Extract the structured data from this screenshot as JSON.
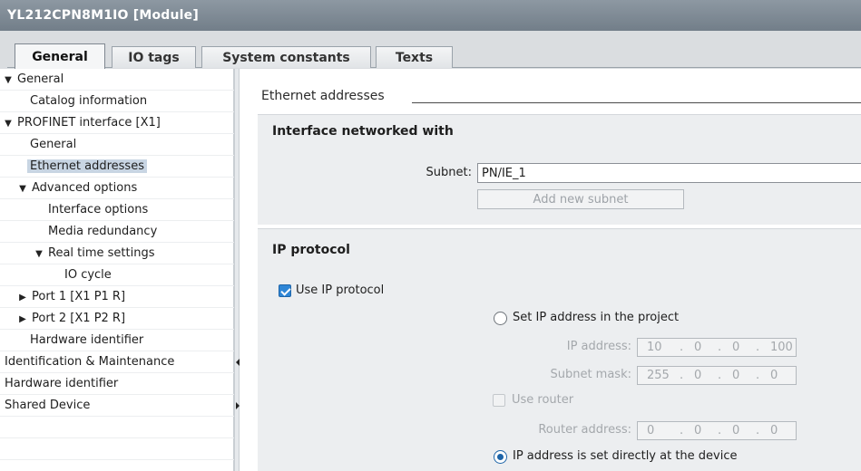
{
  "window": {
    "title": "YL212CPN8M1IO [Module]"
  },
  "tabs": [
    {
      "label": "General",
      "active": true
    },
    {
      "label": "IO tags",
      "active": false
    },
    {
      "label": "System constants",
      "active": false
    },
    {
      "label": "Texts",
      "active": false
    }
  ],
  "tree": [
    {
      "label": "General",
      "expander": "expanded"
    },
    {
      "label": "Catalog information",
      "expander": ""
    },
    {
      "label": "PROFINET interface [X1]",
      "expander": "expanded"
    },
    {
      "label": "General",
      "expander": ""
    },
    {
      "label": "Ethernet addresses",
      "expander": "",
      "selected": true
    },
    {
      "label": "Advanced options",
      "expander": "expanded"
    },
    {
      "label": "Interface options",
      "expander": ""
    },
    {
      "label": "Media redundancy",
      "expander": ""
    },
    {
      "label": "Real time settings",
      "expander": "expanded"
    },
    {
      "label": "IO cycle",
      "expander": ""
    },
    {
      "label": "Port 1 [X1 P1 R]",
      "expander": "collapsed"
    },
    {
      "label": "Port 2 [X1 P2 R]",
      "expander": "collapsed"
    },
    {
      "label": "Hardware identifier",
      "expander": ""
    },
    {
      "label": "Identification & Maintenance",
      "expander": ""
    },
    {
      "label": "Hardware identifier",
      "expander": ""
    },
    {
      "label": "Shared Device",
      "expander": ""
    }
  ],
  "main": {
    "section_header": "Ethernet addresses",
    "interface": {
      "title": "Interface networked with",
      "subnet_label": "Subnet:",
      "subnet_value": "PN/IE_1",
      "add_subnet_label": "Add new subnet"
    },
    "ip": {
      "title": "IP protocol",
      "use_ip_label": "Use IP protocol",
      "use_ip_checked": true,
      "set_in_project_label": "Set IP address in the project",
      "set_in_project_selected": false,
      "ip_address_label": "IP address:",
      "ip_address": [
        "10",
        "0",
        "0",
        "100"
      ],
      "subnet_mask_label": "Subnet mask:",
      "subnet_mask": [
        "255",
        "0",
        "0",
        "0"
      ],
      "use_router_label": "Use router",
      "use_router_checked": false,
      "router_address_label": "Router address:",
      "router_address": [
        "0",
        "0",
        "0",
        "0"
      ],
      "set_at_device_label": "IP address is set directly at the device",
      "set_at_device_selected": true
    }
  },
  "colors": {
    "title_bar": "#7f8a95",
    "selection": "#c8d5e3",
    "section_bg": "#eceef0",
    "accent": "#2f86d6"
  }
}
